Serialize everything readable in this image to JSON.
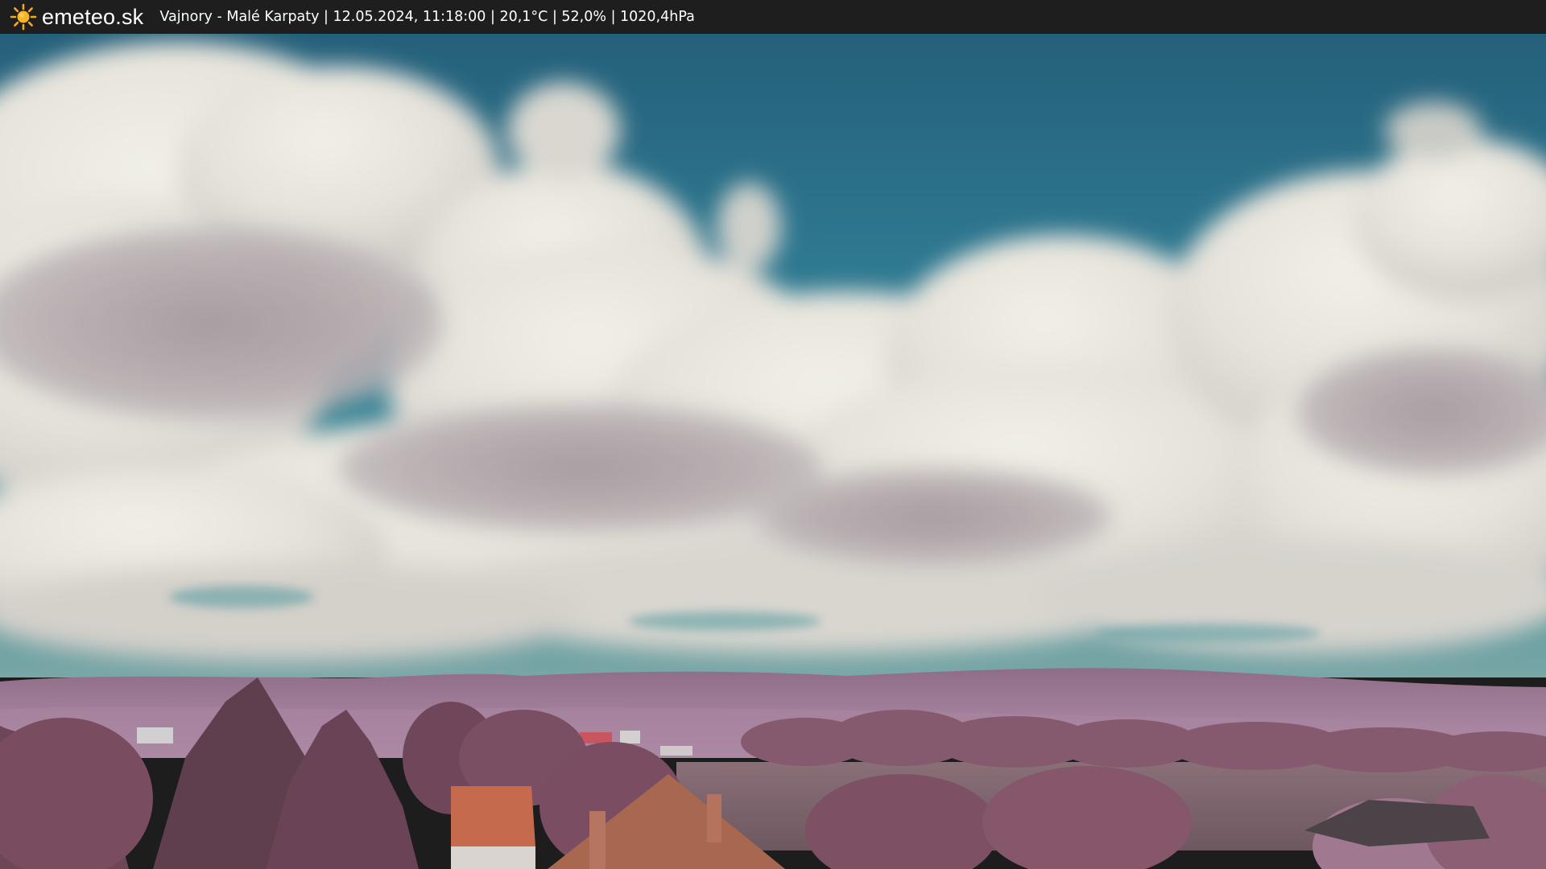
{
  "header": {
    "brand": "emeteo.sk",
    "brand_icon": "sun-icon",
    "station_info": "Vajnory - Malé Karpaty | 12.05.2024, 11:18:00 | 20,1°C | 52,0% | 1020,4hPa"
  },
  "colors": {
    "bar_background": "#1e1e1e",
    "sun": "#f5a91e",
    "sky": "#2e7890",
    "hills": "#a47f9c",
    "foliage": "#7b4d62"
  }
}
